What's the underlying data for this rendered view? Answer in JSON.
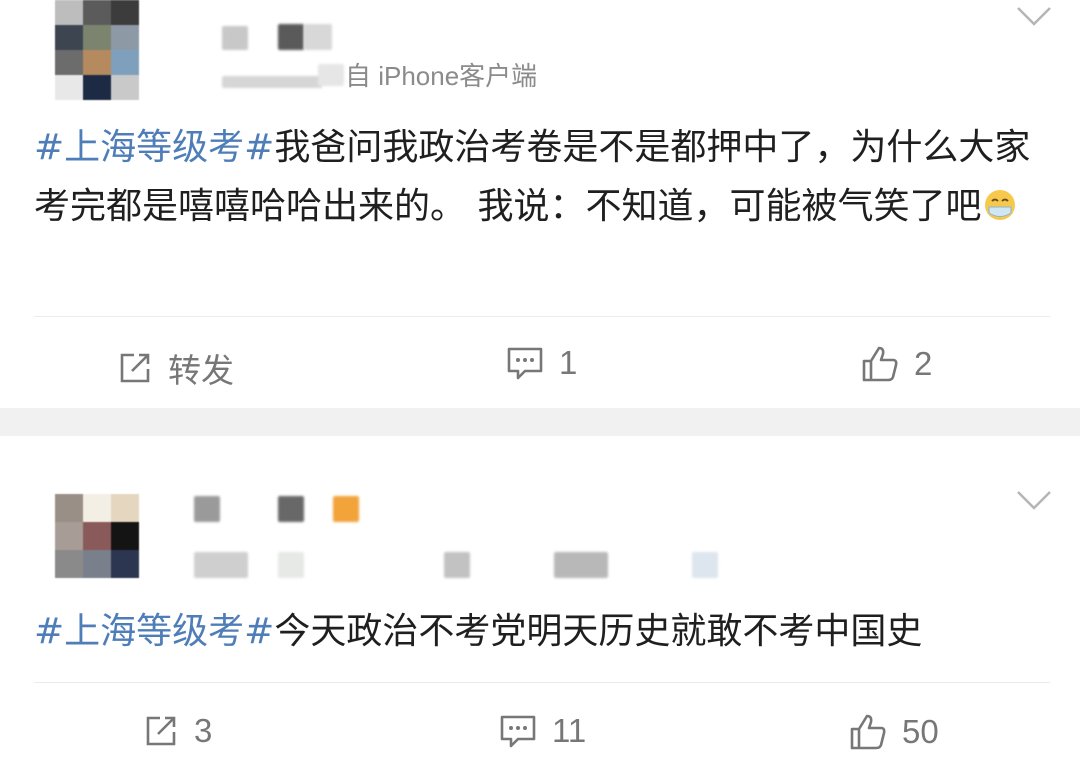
{
  "posts": [
    {
      "source": "自 iPhone客户端",
      "topic": "#上海等级考#",
      "text": "我爸问我政治考卷是不是都押中了，为什么大家考完都是嘻嘻哈哈出来的。 我说：不知道，可能被气笑了吧",
      "emoji": "mask-face-emoji",
      "actions": {
        "repost": "转发",
        "comments": "1",
        "likes": "2"
      }
    },
    {
      "topic": "#上海等级考#",
      "text": "今天政治不考党明天历史就敢不考中国史",
      "actions": {
        "repost": "3",
        "comments": "11",
        "likes": "50"
      }
    }
  ],
  "colors": {
    "topic": "#4f7db8",
    "icon": "#777777",
    "separator": "#f1f1f1"
  }
}
